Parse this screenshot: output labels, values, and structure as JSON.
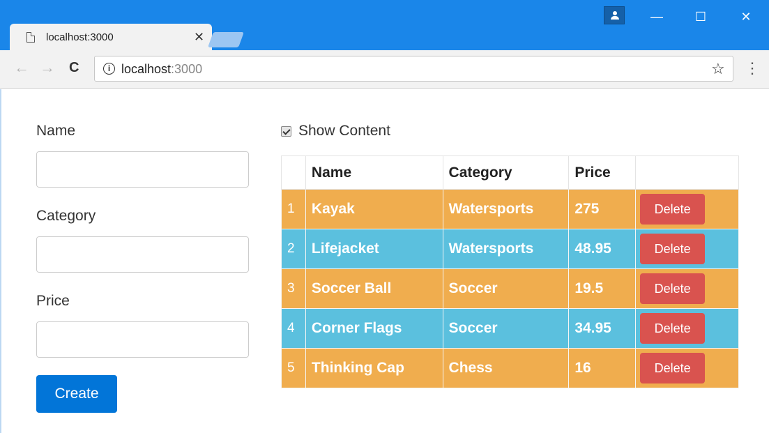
{
  "browser": {
    "tab_title": "localhost:3000",
    "tab_close": "✕",
    "url_host": "localhost",
    "url_port": ":3000",
    "window_controls": {
      "minimize": "—",
      "maximize": "☐",
      "close": "✕"
    },
    "nav": {
      "back": "←",
      "forward": "→",
      "reload": "C",
      "star": "☆",
      "menu": "⋮",
      "info": "i"
    }
  },
  "form": {
    "name_label": "Name",
    "name_value": "",
    "category_label": "Category",
    "category_value": "",
    "price_label": "Price",
    "price_value": "",
    "create_label": "Create"
  },
  "table": {
    "show_content_label": "Show Content",
    "show_content_checked": true,
    "headers": [
      "",
      "Name",
      "Category",
      "Price",
      ""
    ],
    "row_colors": {
      "odd": "#f0ad4e",
      "even": "#5bc0de"
    },
    "rows": [
      {
        "index": "1",
        "name": "Kayak",
        "category": "Watersports",
        "price": "275",
        "action": "Delete"
      },
      {
        "index": "2",
        "name": "Lifejacket",
        "category": "Watersports",
        "price": "48.95",
        "action": "Delete"
      },
      {
        "index": "3",
        "name": "Soccer Ball",
        "category": "Soccer",
        "price": "19.5",
        "action": "Delete"
      },
      {
        "index": "4",
        "name": "Corner Flags",
        "category": "Soccer",
        "price": "34.95",
        "action": "Delete"
      },
      {
        "index": "5",
        "name": "Thinking Cap",
        "category": "Chess",
        "price": "16",
        "action": "Delete"
      }
    ]
  },
  "colors": {
    "titlebar": "#1a86e9",
    "primary": "#0275d8",
    "danger": "#d9534f"
  }
}
